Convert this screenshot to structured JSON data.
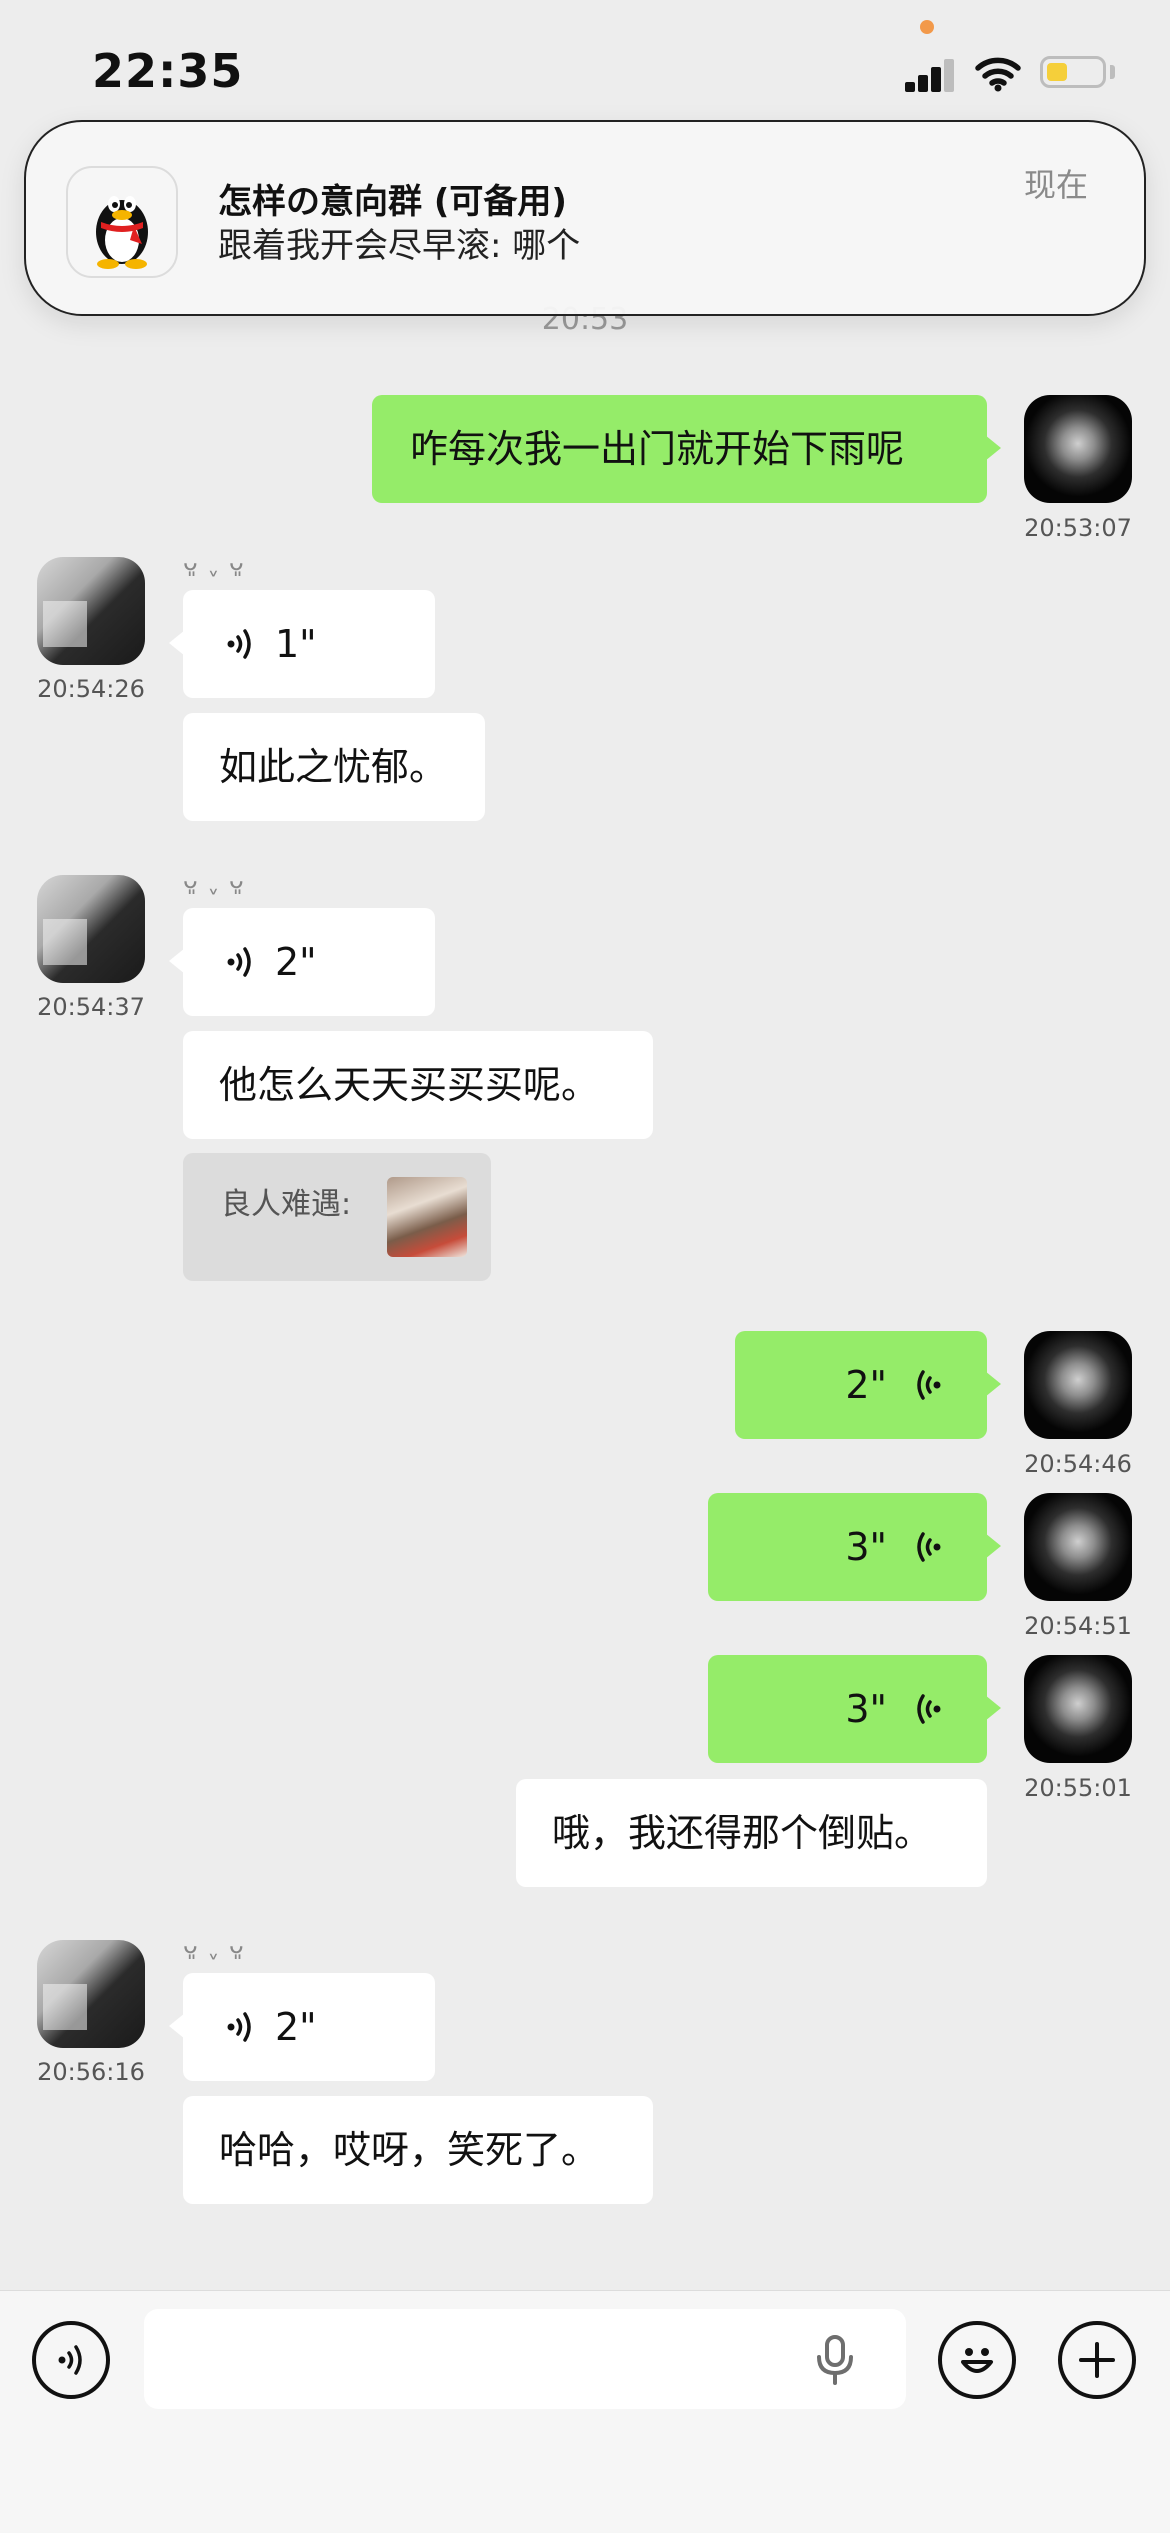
{
  "status_bar": {
    "time": "22:35"
  },
  "notification": {
    "title": "怎样の意向群 (可备用)",
    "body": "跟着我开会尽早滚: 哪个",
    "time": "现在"
  },
  "chat": {
    "time_divider": "20:53",
    "messages": [
      {
        "text": "咋每次我一出门就开始下雨呢",
        "time": "20:53:07"
      },
      {
        "nickname": "ᴗ͈ ˬ ᴗ͈",
        "voice": "1\"",
        "text": "如此之忧郁。",
        "time": "20:54:26"
      },
      {
        "nickname": "ᴗ͈ ˬ ᴗ͈",
        "voice": "2\"",
        "text": "他怎么天天买买买呢。",
        "reply_name": "良人难遇:",
        "time": "20:54:37"
      },
      {
        "voice": "2\"",
        "time": "20:54:46"
      },
      {
        "voice": "3\"",
        "time": "20:54:51"
      },
      {
        "voice": "3\"",
        "time": "20:55:01"
      },
      {
        "text": "哦，我还得那个倒贴。"
      },
      {
        "nickname": "ᴗ͈ ˬ ᴗ͈",
        "voice": "2\"",
        "text": "哈哈，哎呀，笑死了。",
        "time": "20:56:16"
      }
    ]
  },
  "colors": {
    "my_bubble": "#95ec69",
    "other_bubble": "#ffffff",
    "background": "#ededed"
  }
}
